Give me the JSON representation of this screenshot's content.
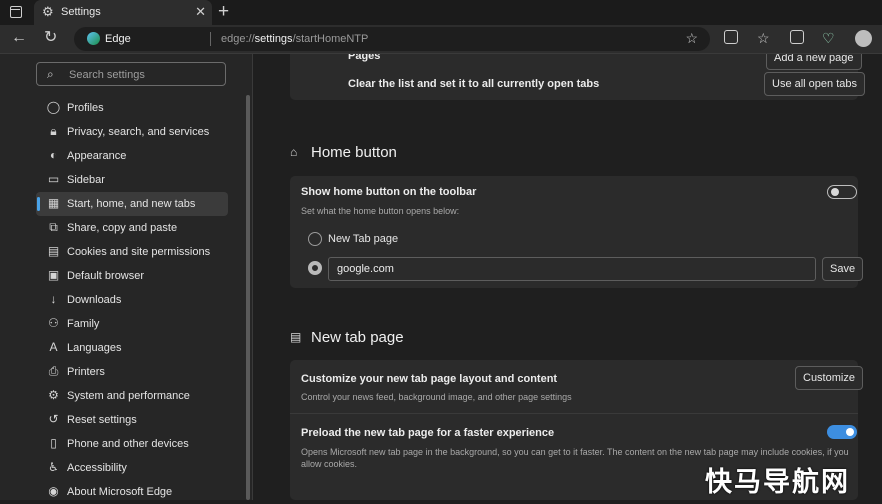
{
  "tab": {
    "title": "Settings"
  },
  "address": {
    "site_label": "Edge",
    "url_prefix": "edge://",
    "url_bold": "settings",
    "url_suffix": "/startHomeNTP"
  },
  "sidebar": {
    "search_placeholder": "Search settings",
    "items": [
      {
        "label": "Profiles",
        "icon": "profile-icon"
      },
      {
        "label": "Privacy, search, and services",
        "icon": "lock-icon"
      },
      {
        "label": "Appearance",
        "icon": "appearance-icon"
      },
      {
        "label": "Sidebar",
        "icon": "sidebar-icon"
      },
      {
        "label": "Start, home, and new tabs",
        "icon": "start-home-icon",
        "active": true
      },
      {
        "label": "Share, copy and paste",
        "icon": "share-icon"
      },
      {
        "label": "Cookies and site permissions",
        "icon": "cookies-icon"
      },
      {
        "label": "Default browser",
        "icon": "default-browser-icon"
      },
      {
        "label": "Downloads",
        "icon": "download-icon"
      },
      {
        "label": "Family",
        "icon": "family-icon"
      },
      {
        "label": "Languages",
        "icon": "languages-icon"
      },
      {
        "label": "Printers",
        "icon": "printer-icon"
      },
      {
        "label": "System and performance",
        "icon": "system-icon"
      },
      {
        "label": "Reset settings",
        "icon": "reset-icon"
      },
      {
        "label": "Phone and other devices",
        "icon": "phone-icon"
      },
      {
        "label": "Accessibility",
        "icon": "accessibility-icon"
      },
      {
        "label": "About Microsoft Edge",
        "icon": "edge-icon"
      }
    ]
  },
  "startup_card": {
    "pages_label": "Pages",
    "add_page_button": "Add a new page",
    "clear_list_label": "Clear the list and set it to all currently open tabs",
    "use_all_tabs_button": "Use all open tabs"
  },
  "home_button": {
    "section_title": "Home button",
    "show_label": "Show home button on the toolbar",
    "toggle_on": false,
    "sub_label": "Set what the home button opens below:",
    "option_new_tab": "New Tab page",
    "url_value": "google.com",
    "save_button": "Save"
  },
  "new_tab_page": {
    "section_title": "New tab page",
    "customize_label": "Customize your new tab page layout and content",
    "customize_sub": "Control your news feed, background image, and other page settings",
    "customize_button": "Customize",
    "preload_label": "Preload the new tab page for a faster experience",
    "preload_toggle_on": true,
    "preload_sub": "Opens Microsoft new tab page in the background, so you can get to it faster. The content on the new tab page may include cookies, if you allow cookies."
  },
  "watermark": "快马导航网"
}
